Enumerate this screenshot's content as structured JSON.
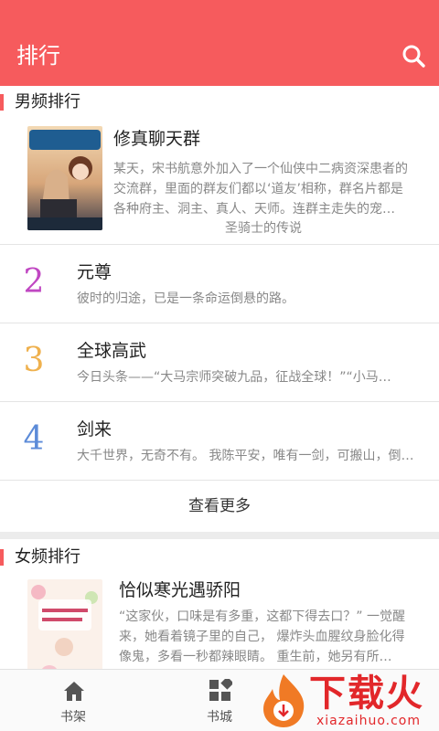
{
  "appbar": {
    "title": "排行",
    "search_icon": "search-icon"
  },
  "male": {
    "heading": "男频排行",
    "top": {
      "title": "修真聊天群",
      "desc": "某天，宋书航意外加入了一个仙侠中二病资深患者的交流群，里面的群友们都以‘道友’相称，群名片都是各种府主、洞主、真人、天师。连群主走失的宠…",
      "author": "圣骑士的传说",
      "cover_text": "修真聊天群",
      "cover_author": "圣骑士的传说"
    },
    "items": [
      {
        "rank": "2",
        "title": "元尊",
        "desc": "彼时的归途，已是一条命运倒悬的路。",
        "color": "#c047c2"
      },
      {
        "rank": "3",
        "title": "全球高武",
        "desc": "今日头条——“大马宗师突破九品，征战全球！”“小马…",
        "color": "#efb14e"
      },
      {
        "rank": "4",
        "title": "剑来",
        "desc": "大千世界，无奇不有。 我陈平安，唯有一剑，可搬山，倒…",
        "color": "#5c8bd8"
      }
    ],
    "more": "查看更多"
  },
  "female": {
    "heading": "女频排行",
    "top": {
      "title": "恰似寒光遇骄阳",
      "desc": "“这家伙，口味是有多重，这都下得去口？” 一觉醒来，她看着镜子里的自己， 爆炸头血腥纹身脸化得像鬼，多看一秒都辣眼睛。 重生前，她另有所…",
      "cover_text": "恰似寒光遇骄阳"
    }
  },
  "tabs": [
    {
      "label": "书架",
      "icon": "home-icon"
    },
    {
      "label": "书城",
      "icon": "grid-icon"
    }
  ],
  "watermark": {
    "text": "下载火",
    "sub": "xiazaihuo.com"
  },
  "colors": {
    "accent": "#f65b5d"
  }
}
